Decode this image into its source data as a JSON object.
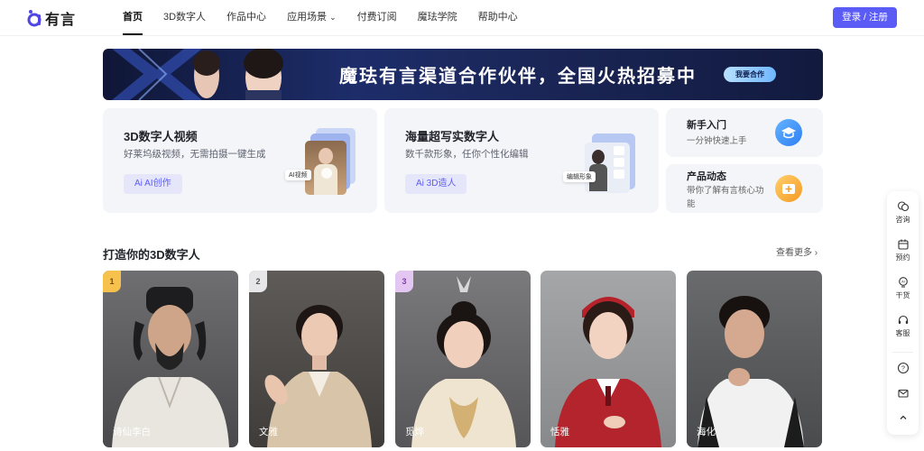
{
  "header": {
    "logo_text": "有言",
    "nav": [
      {
        "label": "首页",
        "active": true
      },
      {
        "label": "3D数字人"
      },
      {
        "label": "作品中心"
      },
      {
        "label": "应用场景",
        "dropdown": true
      },
      {
        "label": "付费订阅"
      },
      {
        "label": "魔珐学院"
      },
      {
        "label": "帮助中心"
      }
    ],
    "login_label": "登录 / 注册"
  },
  "banner": {
    "title": "魔珐有言渠道合作伙伴，全国火热招募中",
    "button_label": "我要合作"
  },
  "cards": {
    "video": {
      "title": "3D数字人视频",
      "subtitle": "好莱坞级视频，无需拍摄一键生成",
      "button_label": "Ai AI创作",
      "tag": "AI视频"
    },
    "avatar": {
      "title": "海量超写实数字人",
      "subtitle": "数千款形象，任你个性化编辑",
      "button_label": "Ai 3D造人",
      "tag": "编辑形象"
    },
    "beginner": {
      "title": "新手入门",
      "subtitle": "一分钟快速上手"
    },
    "news": {
      "title": "产品动态",
      "subtitle": "带你了解有言核心功能"
    }
  },
  "section": {
    "title": "打造你的3D数字人",
    "see_more": "查看更多"
  },
  "avatars": [
    {
      "name": "诗仙李白",
      "rank": "1"
    },
    {
      "name": "文雅",
      "rank": "2"
    },
    {
      "name": "觅烨",
      "rank": "3"
    },
    {
      "name": "恬雅"
    },
    {
      "name": "海化"
    }
  ],
  "rail": [
    {
      "label": "咨询",
      "icon": "chat-icon"
    },
    {
      "label": "预约",
      "icon": "calendar-icon"
    },
    {
      "label": "干货",
      "icon": "bulb-icon"
    },
    {
      "label": "客服",
      "icon": "headset-icon"
    },
    {
      "label": "",
      "icon": "help-icon"
    },
    {
      "label": "",
      "icon": "mail-icon"
    },
    {
      "label": "",
      "icon": "back-to-top-icon"
    }
  ],
  "colors": {
    "accent": "#5b5cf6",
    "card_bg": "#f4f5f8"
  }
}
